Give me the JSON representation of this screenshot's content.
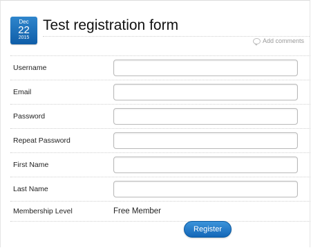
{
  "date": {
    "month": "Dec",
    "day": "22",
    "year": "2015"
  },
  "title": "Test registration form",
  "comments_label": "Add comments",
  "fields": [
    {
      "label": "Username",
      "value": ""
    },
    {
      "label": "Email",
      "value": ""
    },
    {
      "label": "Password",
      "value": ""
    },
    {
      "label": "Repeat Password",
      "value": ""
    },
    {
      "label": "First Name",
      "value": ""
    },
    {
      "label": "Last Name",
      "value": ""
    }
  ],
  "membership": {
    "label": "Membership Level",
    "value": "Free Member"
  },
  "register_label": "Register",
  "colors": {
    "accent": "#1a6fbf",
    "title_text": "#111111",
    "muted_text": "#9a9a9a"
  }
}
